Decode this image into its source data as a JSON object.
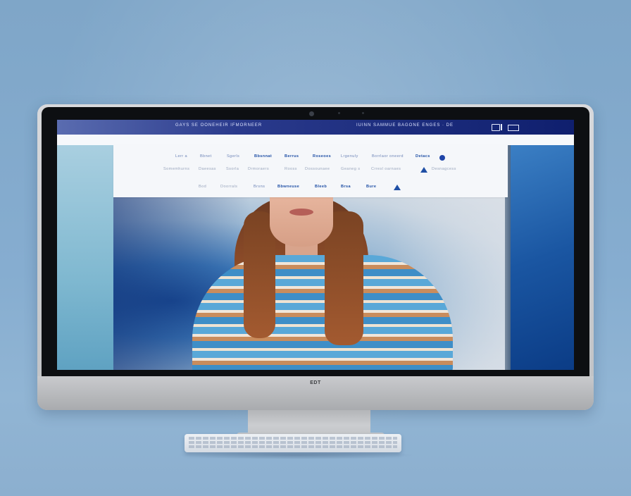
{
  "topbar": {
    "left_text": "GAYS SE OONEHEIR IFMORNEER",
    "right_text": "IUINN SAMMUE BAGONE ENGES · DE"
  },
  "megamenu": {
    "row1": [
      "Lerr a",
      "Bbnet",
      "Sgerls",
      "Bbsnnat",
      "Berrus",
      "Roseoes",
      "Lrgenuly",
      "Borrlaor oneerd",
      "Detacs"
    ],
    "row2": [
      "Somemhurns",
      "Daeesas",
      "Ssorla",
      "Drmoraers",
      "Rooss",
      "Dossounaee",
      "Geaneg s",
      "Crresl oarnaes",
      "Desnagcess"
    ],
    "row3": [
      "Bod",
      "Doorrals",
      "Brsns",
      "Bbwneuse",
      "Bleeb",
      "Brsa",
      "Bure"
    ]
  },
  "chin": {
    "logo_text": "EDT"
  },
  "icons": [
    "circle-icon",
    "triangle-icon",
    "window-icon",
    "camera-icon"
  ],
  "colors": {
    "nav_dark": "#0f1f6e",
    "accent": "#1f4fa5",
    "background": "#86add0"
  }
}
